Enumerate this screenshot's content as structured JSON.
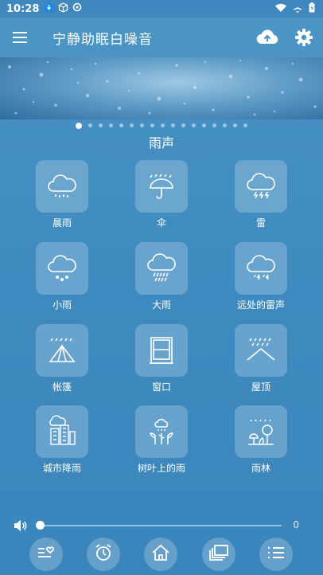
{
  "status_bar": {
    "time": "10:28"
  },
  "app": {
    "title": "宁静助眠白噪音"
  },
  "carousel": {
    "page_count": 17,
    "active_index": 0
  },
  "section": {
    "title": "雨声"
  },
  "sounds": [
    {
      "label": "晨雨",
      "icon": "cloud-rain-icon"
    },
    {
      "label": "伞",
      "icon": "umbrella-rain-icon"
    },
    {
      "label": "雷",
      "icon": "cloud-lightning-icon"
    },
    {
      "label": "小雨",
      "icon": "cloud-light-rain-icon"
    },
    {
      "label": "大雨",
      "icon": "cloud-heavy-rain-icon"
    },
    {
      "label": "远处的雷声",
      "icon": "cloud-distant-thunder-icon"
    },
    {
      "label": "帐篷",
      "icon": "tent-icon"
    },
    {
      "label": "窗口",
      "icon": "window-icon"
    },
    {
      "label": "屋顶",
      "icon": "roof-icon"
    },
    {
      "label": "城市降雨",
      "icon": "city-rain-icon"
    },
    {
      "label": "树叶上的雨",
      "icon": "leaves-rain-icon"
    },
    {
      "label": "雨林",
      "icon": "rainforest-icon"
    }
  ],
  "volume": {
    "value": "0",
    "level": 0
  },
  "bottom_nav": [
    {
      "icon": "favorites-list-icon"
    },
    {
      "icon": "alarm-clock-icon"
    },
    {
      "icon": "home-icon"
    },
    {
      "icon": "layers-icon"
    },
    {
      "icon": "list-icon"
    }
  ]
}
